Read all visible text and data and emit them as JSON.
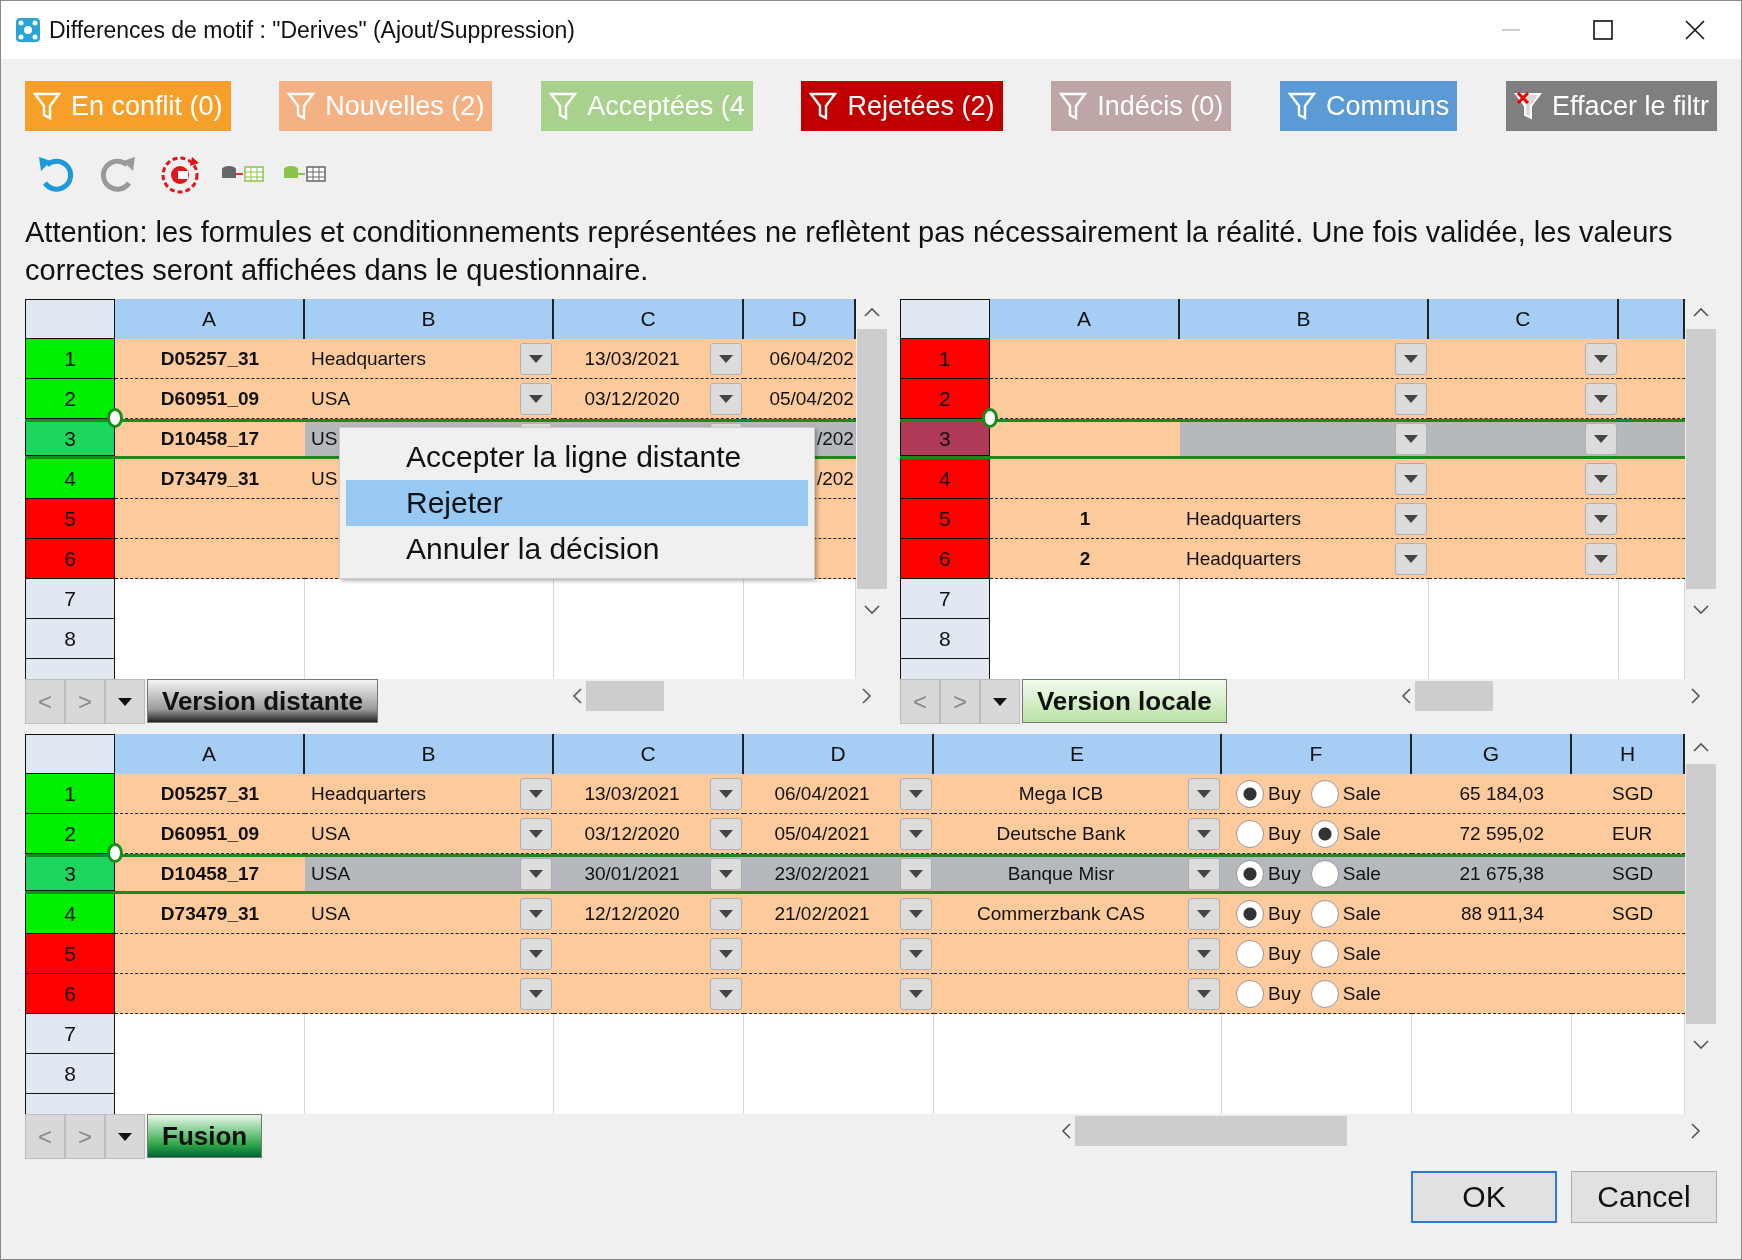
{
  "window": {
    "title": "Differences de motif : \"Derives\" (Ajout/Suppression)"
  },
  "filters": [
    {
      "label": "En conflit (0)",
      "color": "#f6a02a",
      "kind": "filter"
    },
    {
      "label": "Nouvelles (2)",
      "color": "#f4b183",
      "kind": "filter"
    },
    {
      "label": "Acceptées (4",
      "color": "#a8d18d",
      "kind": "filter"
    },
    {
      "label": "Rejetées (2)",
      "color": "#c00000",
      "kind": "filter"
    },
    {
      "label": "Indécis (0)",
      "color": "#bfa6a6",
      "kind": "filter"
    },
    {
      "label": "Communs",
      "color": "#5b9bd5",
      "kind": "filter"
    },
    {
      "label": "Effacer le filtr",
      "color": "#7f7f7f",
      "kind": "clear"
    }
  ],
  "toolbar": [
    {
      "kind": "undo",
      "disabled": false
    },
    {
      "kind": "redo",
      "disabled": true
    },
    {
      "kind": "reset"
    },
    {
      "kind": "export"
    },
    {
      "kind": "import"
    }
  ],
  "warning": "Attention: les formules et conditionnements représentées ne reflètent pas nécessairement la réalité. Une fois validée, les valeurs correctes seront affichées dans le questionnaire.",
  "panels": [
    {
      "kind": "distant",
      "tab": {
        "label": "Version distante"
      },
      "nav": [
        "<",
        ">"
      ],
      "columns": [
        {
          "label": "A",
          "kind": "id"
        },
        {
          "label": "B",
          "kind": "list"
        },
        {
          "label": "C",
          "kind": "pick"
        },
        {
          "label": "D",
          "kind": "edge"
        }
      ],
      "rows": [
        {
          "label": "1",
          "color": "#00ee00",
          "kind": "change",
          "selected": false,
          "cells": [
            "D05257_31",
            "Headquarters",
            "13/03/2021",
            "06/04/202"
          ]
        },
        {
          "label": "2",
          "color": "#00ee00",
          "kind": "change",
          "selected": false,
          "cells": [
            "D60951_09",
            "USA",
            "03/12/2020",
            "05/04/202"
          ]
        },
        {
          "label": "3",
          "color": "#1ed65e",
          "kind": "change",
          "selected": true,
          "cells": [
            "D10458_17",
            "US",
            null,
            "/202"
          ]
        },
        {
          "label": "4",
          "color": "#00ee00",
          "kind": "change",
          "selected": false,
          "cells": [
            "D73479_31",
            "US",
            null,
            "/202"
          ]
        },
        {
          "label": "5",
          "color": "#ff0000",
          "kind": "change",
          "selected": false,
          "cells": []
        },
        {
          "label": "6",
          "color": "#ff0000",
          "kind": "change",
          "selected": false,
          "cells": []
        },
        {
          "label": "7",
          "kind": "blank",
          "selected": false,
          "cells": []
        },
        {
          "label": "8",
          "kind": "blank",
          "selected": false,
          "cells": []
        }
      ],
      "menu": {
        "items": [
          {
            "label": "Accepter la ligne distante",
            "selected": false
          },
          {
            "label": "Rejeter",
            "selected": true
          },
          {
            "label": "Annuler la décision",
            "selected": false
          }
        ]
      }
    },
    {
      "kind": "local",
      "tab": {
        "label": "Version locale"
      },
      "nav": [
        "<",
        ">"
      ],
      "columns": [
        {
          "label": "A",
          "kind": "id"
        },
        {
          "label": "B",
          "kind": "list"
        },
        {
          "label": "C",
          "kind": "list"
        },
        {
          "kind": "edge"
        }
      ],
      "rows": [
        {
          "label": "1",
          "color": "#ff0000",
          "kind": "change",
          "selected": false,
          "cells": []
        },
        {
          "label": "2",
          "color": "#ff0000",
          "kind": "change",
          "selected": false,
          "cells": []
        },
        {
          "label": "3",
          "color": "#b03a58",
          "kind": "change",
          "selected": true,
          "cells": []
        },
        {
          "label": "4",
          "color": "#ff0000",
          "kind": "change",
          "selected": false,
          "cells": []
        },
        {
          "label": "5",
          "color": "#ff0000",
          "kind": "change",
          "selected": false,
          "cells": [
            "1",
            "Headquarters"
          ]
        },
        {
          "label": "6",
          "color": "#ff0000",
          "kind": "change",
          "selected": false,
          "cells": [
            "2",
            "Headquarters"
          ]
        },
        {
          "label": "7",
          "kind": "blank",
          "selected": false,
          "cells": []
        },
        {
          "label": "8",
          "kind": "blank",
          "selected": false,
          "cells": []
        }
      ]
    },
    {
      "kind": "merged",
      "tab": {
        "label": "Fusion"
      },
      "nav": [
        "<",
        ">"
      ],
      "columns": [
        {
          "label": "A",
          "kind": "id"
        },
        {
          "label": "B",
          "kind": "list"
        },
        {
          "label": "C",
          "kind": "pick"
        },
        {
          "label": "D",
          "kind": "pick"
        },
        {
          "label": "E",
          "kind": "pick"
        },
        {
          "label": "F",
          "kind": "radio"
        },
        {
          "label": "G",
          "kind": "amount"
        },
        {
          "label": "H",
          "kind": "code"
        }
      ],
      "rows": [
        {
          "label": "1",
          "color": "#00ee00",
          "kind": "change",
          "selected": false,
          "cells": [
            "D05257_31",
            "Headquarters",
            "13/03/2021",
            "06/04/2021",
            "Mega ICB",
            {
              "options": [
                {
                  "label": "Buy",
                  "selected": true
                },
                {
                  "label": "Sale",
                  "selected": false
                }
              ]
            },
            "65 184,03",
            "SGD"
          ]
        },
        {
          "label": "2",
          "color": "#00ee00",
          "kind": "change",
          "selected": false,
          "cells": [
            "D60951_09",
            "USA",
            "03/12/2020",
            "05/04/2021",
            "Deutsche Bank",
            {
              "options": [
                {
                  "label": "Buy",
                  "selected": false
                },
                {
                  "label": "Sale",
                  "selected": true
                }
              ]
            },
            "72 595,02",
            "EUR"
          ]
        },
        {
          "label": "3",
          "color": "#1ed65e",
          "kind": "change",
          "selected": true,
          "cells": [
            "D10458_17",
            "USA",
            "30/01/2021",
            "23/02/2021",
            "Banque Misr",
            {
              "options": [
                {
                  "label": "Buy",
                  "selected": true
                },
                {
                  "label": "Sale",
                  "selected": false
                }
              ]
            },
            "21 675,38",
            "SGD"
          ]
        },
        {
          "label": "4",
          "color": "#00ee00",
          "kind": "change",
          "selected": false,
          "cells": [
            "D73479_31",
            "USA",
            "12/12/2020",
            "21/02/2021",
            "Commerzbank CAS",
            {
              "options": [
                {
                  "label": "Buy",
                  "selected": true
                },
                {
                  "label": "Sale",
                  "selected": false
                }
              ]
            },
            "88 911,34",
            "SGD"
          ]
        },
        {
          "label": "5",
          "color": "#ff0000",
          "kind": "change",
          "selected": false,
          "cells": [
            null,
            null,
            null,
            null,
            null,
            {
              "options": [
                {
                  "label": "Buy",
                  "selected": false
                },
                {
                  "label": "Sale",
                  "selected": false
                }
              ]
            }
          ]
        },
        {
          "label": "6",
          "color": "#ff0000",
          "kind": "change",
          "selected": false,
          "cells": [
            null,
            null,
            null,
            null,
            null,
            {
              "options": [
                {
                  "label": "Buy",
                  "selected": false
                },
                {
                  "label": "Sale",
                  "selected": false
                }
              ]
            }
          ]
        },
        {
          "label": "7",
          "kind": "blank",
          "selected": false,
          "cells": []
        },
        {
          "label": "8",
          "kind": "blank",
          "selected": false,
          "cells": []
        }
      ]
    }
  ],
  "buttons": [
    {
      "label": "OK",
      "default": true
    },
    {
      "label": "Cancel",
      "default": false
    }
  ]
}
